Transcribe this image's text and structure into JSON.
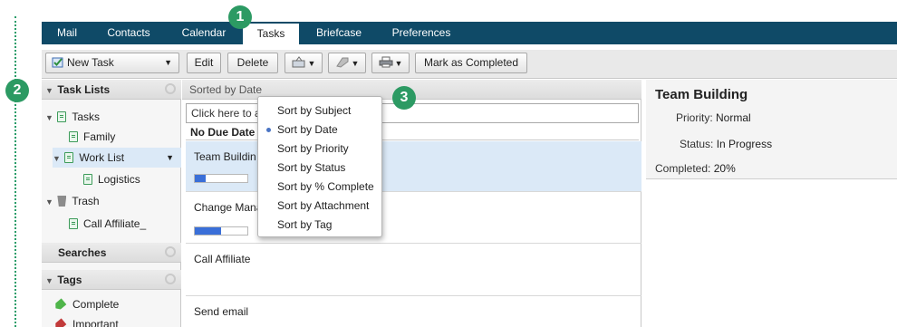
{
  "tabs": [
    {
      "label": "Mail",
      "active": false
    },
    {
      "label": "Contacts",
      "active": false
    },
    {
      "label": "Calendar",
      "active": false
    },
    {
      "label": "Tasks",
      "active": true
    },
    {
      "label": "Briefcase",
      "active": false
    },
    {
      "label": "Preferences",
      "active": false
    }
  ],
  "toolbar": {
    "new_task_label": "New Task",
    "edit_label": "Edit",
    "delete_label": "Delete",
    "mark_completed_label": "Mark as Completed",
    "icons": [
      "new-task-icon",
      "move-icon",
      "tag-icon",
      "print-icon"
    ]
  },
  "sidebar": {
    "task_lists_header": "Task Lists",
    "items": [
      {
        "label": "Tasks"
      },
      {
        "label": "Family"
      },
      {
        "label": "Work List",
        "selected": true
      },
      {
        "label": "Logistics"
      },
      {
        "label": "Trash"
      },
      {
        "label": "Call Affiliate_"
      }
    ],
    "searches_header": "Searches",
    "tags_header": "Tags",
    "tags": [
      {
        "label": "Complete",
        "color": "#4fb54a"
      },
      {
        "label": "Important",
        "color": "#c23b3b"
      }
    ]
  },
  "list": {
    "sort_header": "Sorted by Date",
    "quick_add_placeholder": "Click here to a",
    "group_label": "No Due Date",
    "tasks": [
      {
        "name": "Team Buildin",
        "progress": 0.2,
        "selected": true
      },
      {
        "name": "Change Mana",
        "progress": 0.5
      },
      {
        "name": "Call Affiliate"
      },
      {
        "name": "Send email"
      }
    ]
  },
  "sort_menu": {
    "items": [
      {
        "label": "Sort by Subject",
        "checked": false
      },
      {
        "label": "Sort by Date",
        "checked": true
      },
      {
        "label": "Sort by Priority",
        "checked": false
      },
      {
        "label": "Sort by Status",
        "checked": false
      },
      {
        "label": "Sort by % Complete",
        "checked": false
      },
      {
        "label": "Sort by Attachment",
        "checked": false
      },
      {
        "label": "Sort by Tag",
        "checked": false
      }
    ]
  },
  "detail": {
    "title": "Team Building",
    "priority_label": "Priority:",
    "priority_value": "Normal",
    "status_label": "Status:",
    "status_value": "In Progress",
    "completed_label": "Completed:",
    "completed_value": "20%"
  },
  "callouts": [
    "1",
    "2",
    "3"
  ],
  "colors": {
    "tabbar": "#0f4a67",
    "callout": "#2c9a63",
    "selection": "#dbe9f7",
    "progress": "#3a6fd8"
  }
}
